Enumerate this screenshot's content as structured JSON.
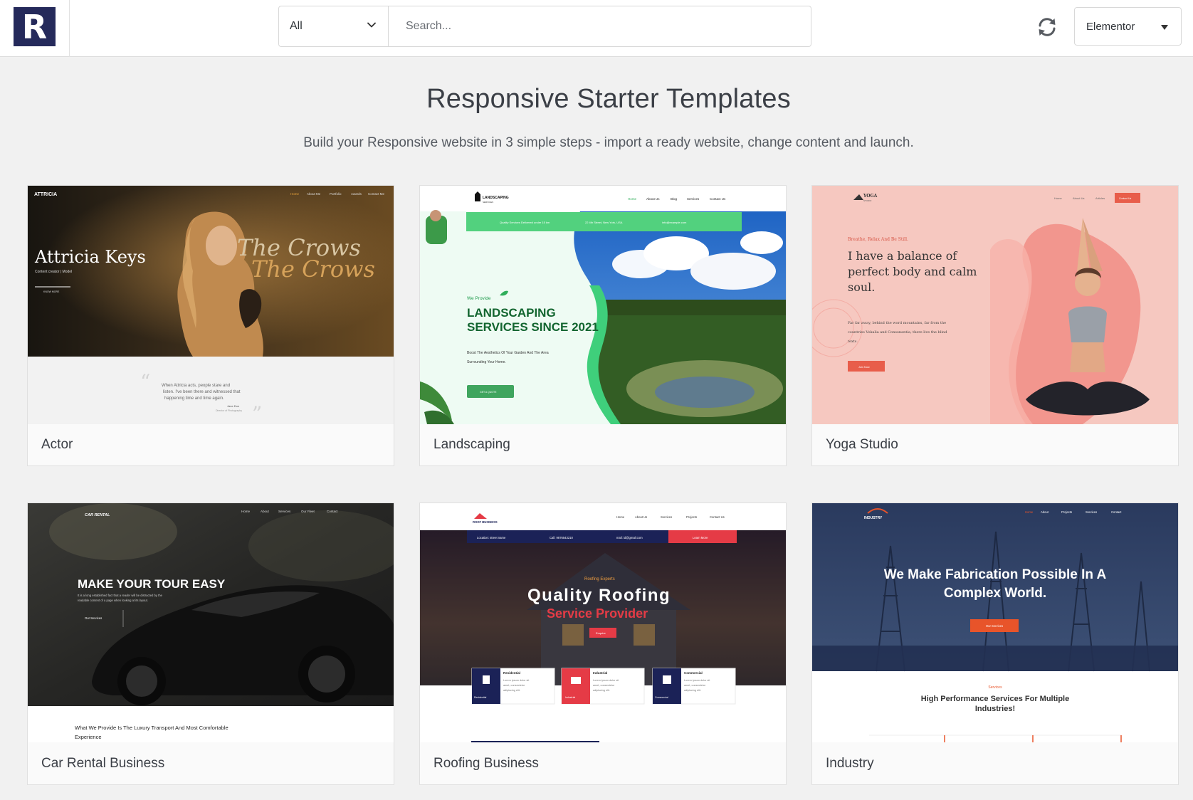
{
  "header": {
    "logo_letter": "R",
    "filter": {
      "selected": "All"
    },
    "search": {
      "placeholder": "Search..."
    },
    "builder": {
      "selected": "Elementor"
    }
  },
  "hero": {
    "title": "Responsive Starter Templates",
    "subtitle": "Build your Responsive website in 3 simple steps - import a ready website, change content and launch."
  },
  "templates": [
    {
      "name": "Actor",
      "preview": {
        "brand": "ATTRICIA",
        "nav": [
          "Home",
          "About Me",
          "Portfolio",
          "Awards",
          "Contact Me"
        ],
        "hero_name": "Attricia Keys",
        "hero_role": "Content creator | Model",
        "hero_button": "KNOW MORE",
        "script_title_1": "The Crows",
        "script_title_2": "The Crows",
        "quote_1": "When Attricia acts, people stare and",
        "quote_2": "listen. I've been there and witnessed that",
        "quote_3": "happening time and time again.",
        "quote_author": "Jane Doe",
        "quote_role": "Director of Photography"
      }
    },
    {
      "name": "Landscaping",
      "preview": {
        "brand": "LANDSCAPING",
        "brand_sub": "SERVICES",
        "nav": [
          "Home",
          "About Us",
          "Blog",
          "Services",
          "Contact Us"
        ],
        "info_1": "Quality Services Delivered under 15 km",
        "info_2": "22 4th Street, New York, USA",
        "info_3": "info@example.com",
        "eyebrow": "We Provide",
        "headline_1": "LANDSCAPING",
        "headline_2": "SERVICES SINCE 2021",
        "body_1": "Boost The Aesthetics Of Your Garden And The Area",
        "body_2": "Surrounding Your Home.",
        "button": "GET A QUOTE"
      }
    },
    {
      "name": "Yoga Studio",
      "preview": {
        "brand": "YOGA",
        "brand_sub": "STUDIO",
        "nav": [
          "Home",
          "About Us",
          "Articles"
        ],
        "nav_button": "Contact Us",
        "eyebrow": "Breathe, Relax And Be Still.",
        "headline_1": "I have a balance of",
        "headline_2": "perfect body and calm",
        "headline_3": "soul.",
        "body_1": "Far far away, behind the word mountains, far from the",
        "body_2": "countries Vokalia and Consonantia, there live the blind",
        "body_3": "texts.",
        "button": "Join Now"
      }
    },
    {
      "name": "Car Rental Business",
      "preview": {
        "brand": "CAR RENTAL",
        "nav": [
          "Home",
          "About",
          "Services",
          "Our Fleet",
          "Contact"
        ],
        "headline": "MAKE YOUR TOUR EASY",
        "body_1": "It is a long established fact that a reader will be distracted by the",
        "body_2": "readable content of a page when looking at its layout.",
        "button": "Our Services",
        "section_1": "What We Provide Is The Luxury Transport And Most Comfortable",
        "section_2": "Experience"
      }
    },
    {
      "name": "Roofing Business",
      "preview": {
        "brand": "ROOF BUSINESS",
        "nav": [
          "Home",
          "About Us",
          "Services",
          "Projects",
          "Contact Us"
        ],
        "info_1": "Location: street name",
        "info_2": "Call: 9876543210",
        "info_3": "mail: id@gmail.com",
        "info_button": "Learn More",
        "eyebrow": "Roofing Experts",
        "headline_1": "Quality Roofing",
        "headline_2": "Service Provider",
        "button": "Enquire",
        "services": [
          {
            "title": "Residential",
            "icon_label": "Residential",
            "text_1": "Lorem ipsum dolor sit",
            "text_2": "amet, consectetur",
            "text_3": "adipiscing elit."
          },
          {
            "title": "Industrial",
            "icon_label": "Industrial",
            "text_1": "Lorem ipsum dolor sit",
            "text_2": "amet, consectetur",
            "text_3": "adipiscing elit."
          },
          {
            "title": "Commercial",
            "icon_label": "Commercial",
            "text_1": "Lorem ipsum dolor sit",
            "text_2": "amet, consectetur",
            "text_3": "adipiscing elit."
          }
        ]
      }
    },
    {
      "name": "Industry",
      "preview": {
        "brand": "INDUSTRY",
        "nav": [
          "Home",
          "About",
          "Projects",
          "Services",
          "Contact"
        ],
        "headline_1": "We Make Fabrication Possible In A",
        "headline_2": "Complex World.",
        "button": "Our Services",
        "eyebrow": "Services",
        "section_1": "High Performance Services For Multiple",
        "section_2": "Industries!"
      }
    }
  ],
  "colors": {
    "logo_bg": "#252a5b",
    "page_bg": "#f1f1f1",
    "landscaping_green": "#1e7a3c",
    "yoga_accent": "#e85d4a",
    "roofing_red": "#e53b46",
    "roofing_navy": "#1b2257",
    "industry_orange": "#e8542a"
  }
}
